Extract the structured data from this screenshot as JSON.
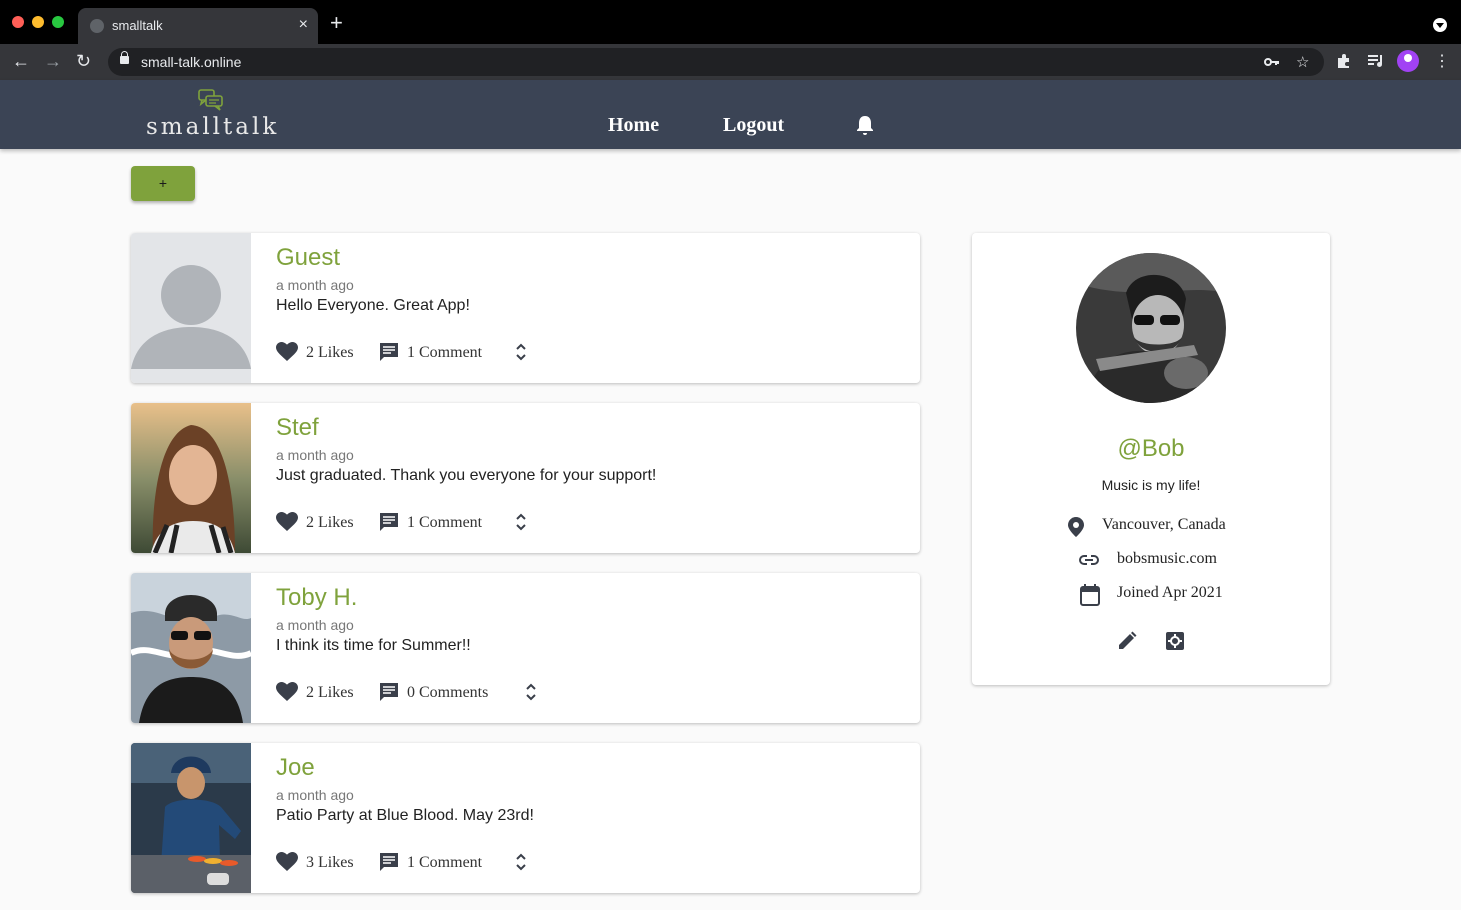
{
  "browser": {
    "tab_title": "smalltalk",
    "tab_close": "×",
    "new_tab": "+",
    "url": "small-talk.online"
  },
  "header": {
    "logo_text": "smalltalk",
    "nav": [
      "Home",
      "Logout"
    ]
  },
  "add_button": "+",
  "posts": [
    {
      "name": "Guest",
      "time": "a month ago",
      "body": "Hello Everyone. Great App!",
      "likes": "2 Likes",
      "comments": "1 Comment"
    },
    {
      "name": "Stef",
      "time": "a month ago",
      "body": "Just graduated. Thank you everyone for your support!",
      "likes": "2 Likes",
      "comments": "1 Comment"
    },
    {
      "name": "Toby H.",
      "time": "a month ago",
      "body": "I think its time for Summer!!",
      "likes": "2 Likes",
      "comments": "0 Comments"
    },
    {
      "name": "Joe",
      "time": "a month ago",
      "body": "Patio Party at Blue Blood. May 23rd!",
      "likes": "3 Likes",
      "comments": "1 Comment"
    }
  ],
  "profile": {
    "handle": "@Bob",
    "bio": "Music is my life!",
    "location": "Vancouver, Canada",
    "website": "bobsmusic.com",
    "joined": "Joined Apr 2021"
  },
  "colors": {
    "accent": "#7fa23c",
    "header_bg": "#3b4455",
    "page_bg": "#fafafa"
  }
}
